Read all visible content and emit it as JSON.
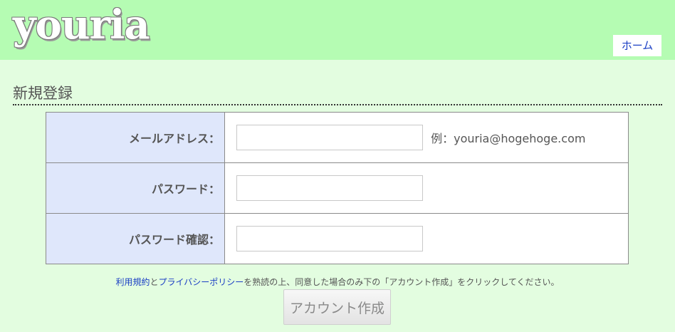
{
  "header": {
    "logo": "youria",
    "home_label": "ホーム"
  },
  "page": {
    "title": "新規登録"
  },
  "form": {
    "email_label": "メールアドレス：",
    "email_value": "",
    "email_hint": "例：youria@hogehoge.com",
    "password_label": "パスワード：",
    "password_value": "",
    "password_confirm_label": "パスワード確認：",
    "password_confirm_value": ""
  },
  "notice": {
    "terms_link": "利用規約",
    "and": "と",
    "privacy_link": "プライバシーポリシー",
    "rest": "を熟読の上、同意した場合のみ下の「アカウント作成」をクリックしてください。"
  },
  "submit_label": "アカウント作成",
  "colors": {
    "header_bg": "#b5fcb3",
    "page_bg": "#e3fde0",
    "label_bg": "#dfe7fb",
    "link": "#1b3fc4"
  }
}
